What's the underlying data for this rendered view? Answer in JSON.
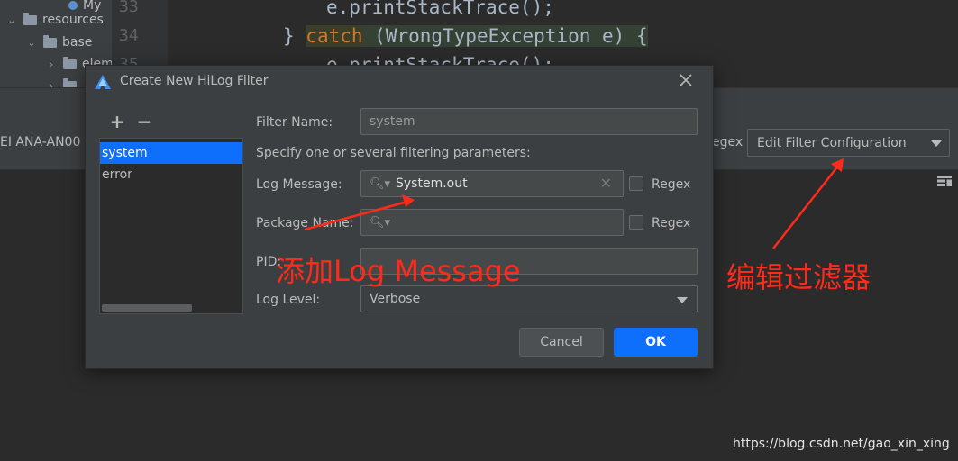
{
  "project_tree": {
    "items": [
      {
        "label": "My",
        "level": 3
      },
      {
        "label": "resources",
        "level": 1
      },
      {
        "label": "base",
        "level": 2
      },
      {
        "label": "elem",
        "level": 3
      },
      {
        "label": "",
        "level": 3
      }
    ]
  },
  "editor": {
    "line_numbers": [
      "33",
      "34",
      "35"
    ],
    "line33": "e.printStackTrace();",
    "line34_brace": "} ",
    "line34_kw": "catch",
    "line34_rest": " (WrongTypeException e) {",
    "line35": "e.printStackTrace();"
  },
  "logcat": {
    "device": "EI ANA-AN00",
    "regex_label": "egex",
    "filter_config": "Edit Filter Configuration"
  },
  "dialog": {
    "title": "Create New HiLog Filter",
    "list_add": "+",
    "list_remove": "−",
    "filters": [
      "system",
      "error"
    ],
    "selected_filter": "system",
    "filter_name_label": "Filter Name:",
    "filter_name_value": "system",
    "hint": "Specify one or several filtering parameters:",
    "log_message_label": "Log Message:",
    "log_message_value": "System.out",
    "package_name_label": "Package Name:",
    "package_name_value": "",
    "pid_label": "PID:",
    "pid_value": "",
    "log_level_label": "Log Level:",
    "log_level_value": "Verbose",
    "regex_label": "Regex",
    "cancel_label": "Cancel",
    "ok_label": "OK"
  },
  "annotations": {
    "note1": "添加Log Message",
    "note2": "编辑过滤器",
    "color": "#ff2a1a"
  },
  "watermark": "https://blog.csdn.net/gao_xin_xing",
  "colors": {
    "accent": "#0d6ffb",
    "dialog_bg": "#3c3f41",
    "editor_bg": "#2b2b2b",
    "keyword": "#cc7832"
  }
}
